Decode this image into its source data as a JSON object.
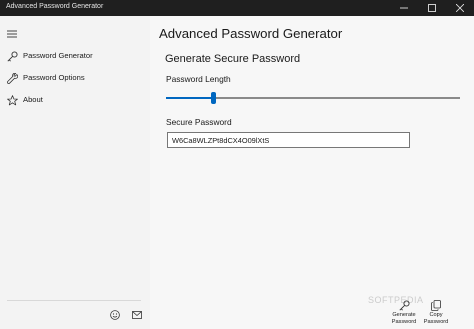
{
  "app": {
    "title": "Advanced Password Generator"
  },
  "window_controls": [
    "minimize-icon",
    "maximize-icon",
    "close-icon"
  ],
  "sidebar": {
    "menu_icon": "hamburger-icon",
    "items": [
      {
        "label": "Password Generator",
        "icon": "key-icon"
      },
      {
        "label": "Password Options",
        "icon": "wrench-icon"
      },
      {
        "label": "About",
        "icon": "star-icon"
      }
    ],
    "footer_icons": [
      "smiley-icon",
      "mail-icon"
    ]
  },
  "main": {
    "heading": "Advanced Password Generator",
    "subheading": "Generate Secure Password",
    "length_label": "Password Length",
    "length_slider_fraction": 0.16,
    "password_label": "Secure Password",
    "password_value": "W6Ca8WLZPt8dCX4O09lXtS"
  },
  "commands": [
    {
      "line1": "Generate",
      "line2": "Password",
      "icon": "key-icon"
    },
    {
      "line1": "Copy",
      "line2": "Password",
      "icon": "copy-icon"
    }
  ],
  "colors": {
    "accent": "#0067c0",
    "titlebar": "#1f1f1f",
    "background": "#f3f3f3"
  }
}
